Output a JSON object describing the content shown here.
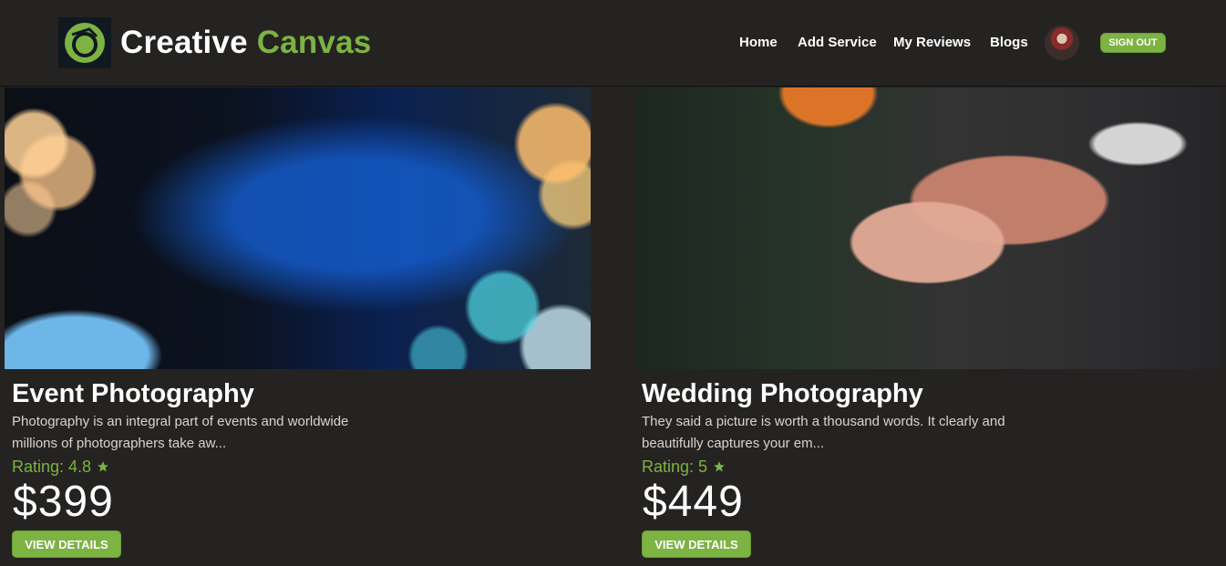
{
  "brand": {
    "name_part1": "Creative",
    "name_part2": "Canvas",
    "logo_icon": "camera-lens-icon"
  },
  "nav": {
    "items": [
      {
        "label": "Home"
      },
      {
        "label": "Add Service"
      },
      {
        "label": "My Reviews"
      },
      {
        "label": "Blogs"
      }
    ],
    "avatar": "user-avatar",
    "signout_label": "SIGN OUT"
  },
  "services": [
    {
      "title": "Event Photography",
      "description": "Photography is an integral part of events and worldwide millions of photographers take aw...",
      "rating_label": "Rating: 4.8",
      "price": "$399",
      "button_label": "VIEW DETAILS",
      "image": "camera-on-tripod-bokeh"
    },
    {
      "title": "Wedding Photography",
      "description": "They said a picture is worth a thousand words. It clearly and beautifully captures your em...",
      "rating_label": "Rating: 5",
      "price": "$449",
      "button_label": "VIEW DETAILS",
      "image": "wedding-rings-hands"
    }
  ],
  "colors": {
    "accent": "#7cb342",
    "background": "#252321",
    "text": "#ffffff"
  }
}
